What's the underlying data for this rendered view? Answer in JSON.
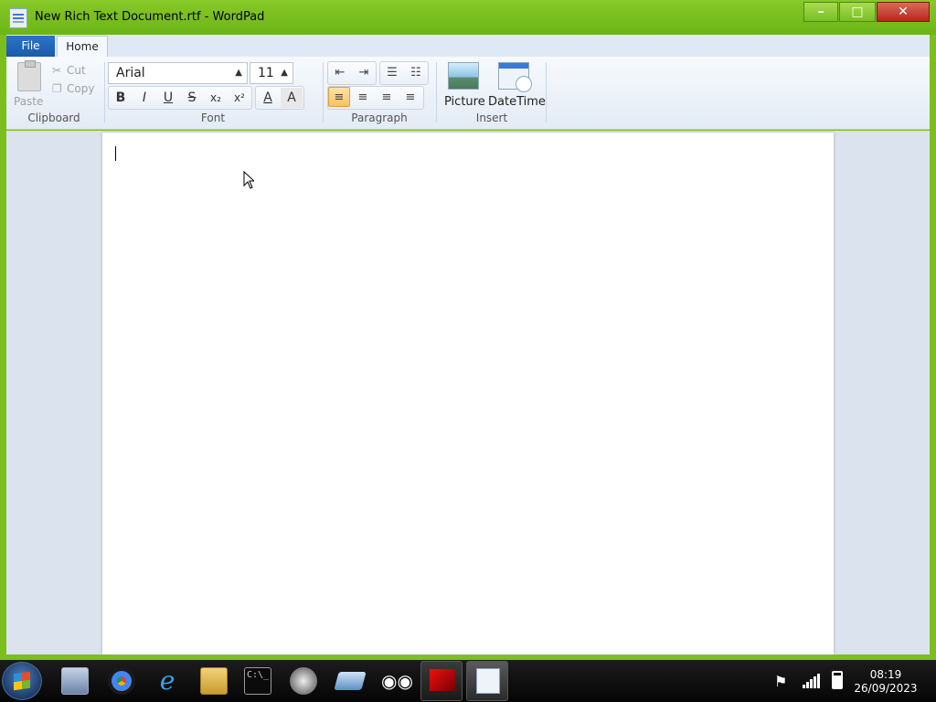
{
  "window": {
    "title": "New Rich Text Document.rtf - WordPad",
    "controls": {
      "minimize": "–",
      "maximize": "□",
      "close": "✕"
    }
  },
  "ribbon": {
    "tabs": [
      {
        "label": "File"
      },
      {
        "label": "Home"
      }
    ],
    "clipboard": {
      "paste": "Paste",
      "cut": "Cut",
      "copy": "Copy",
      "group_label": "Clipboard"
    },
    "font": {
      "family": "Arial",
      "size": "11",
      "bold": "B",
      "italic": "I",
      "underline": "U",
      "strike": "S",
      "subscript": "x₂",
      "superscript": "x²",
      "group_label": "Font"
    },
    "paragraph": {
      "group_label": "Paragraph"
    },
    "insert": {
      "picture": "Picture",
      "datetime": "DateTime",
      "group_label": "Insert"
    }
  },
  "document": {
    "text": ""
  },
  "taskbar": {
    "pinned": [
      "shortcut-icon",
      "chrome-icon",
      "internet-explorer-icon",
      "file-explorer-icon",
      "terminal-icon",
      "settings-gear-icon",
      "drive-icon",
      "eyes-icon",
      "media-player-icon",
      "wordpad-icon"
    ],
    "time": "08:19",
    "date": "26/09/2023"
  }
}
